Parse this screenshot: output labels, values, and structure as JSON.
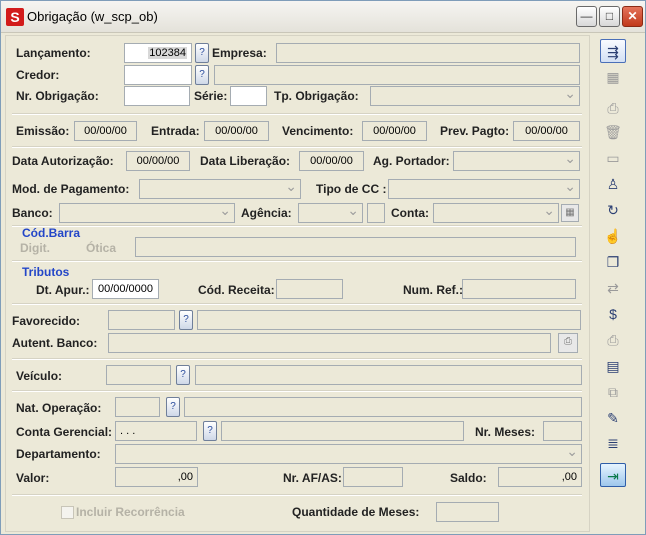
{
  "window": {
    "title": "Obrigação (w_scp_ob)",
    "app_icon": "S",
    "min_glyph": "—",
    "max_glyph": "□",
    "close_glyph": "✕"
  },
  "labels": {
    "lancamento": "Lançamento:",
    "empresa": "Empresa:",
    "credor": "Credor:",
    "nr_obrigacao": "Nr. Obrigação:",
    "serie": "Série:",
    "tp_obrigacao": "Tp. Obrigação:",
    "emissao": "Emissão:",
    "entrada": "Entrada:",
    "vencimento": "Vencimento:",
    "prev_pagto": "Prev. Pagto:",
    "data_autorizacao": "Data Autorização:",
    "data_liberacao": "Data Liberação:",
    "ag_portador": "Ag. Portador:",
    "mod_pagamento": "Mod. de Pagamento:",
    "tipo_cc": "Tipo de CC :",
    "banco": "Banco:",
    "agencia": "Agência:",
    "conta": "Conta:",
    "cod_barra": "Cód.Barra",
    "digit": "Digit.",
    "otica": "Ótica",
    "tributos": "Tributos",
    "dt_apur": "Dt. Apur.:",
    "cod_receita": "Cód. Receita:",
    "num_ref": "Num. Ref.:",
    "favorecido": "Favorecido:",
    "autent_banco": "Autent. Banco:",
    "veiculo": "Veículo:",
    "nat_operacao": "Nat. Operação:",
    "conta_gerencial": "Conta Gerencial:",
    "nr_meses": "Nr. Meses:",
    "departamento": "Departamento:",
    "valor": "Valor:",
    "nr_af_as": "Nr. AF/AS:",
    "saldo": "Saldo:",
    "incluir_recorrencia": "Incluir Recorrência",
    "quantidade_meses": "Quantidade de Meses:"
  },
  "values": {
    "lancamento": "102384",
    "emissao": "00/00/00",
    "entrada": "00/00/00",
    "vencimento": "00/00/00",
    "prev_pagto": "00/00/00",
    "data_autorizacao": "00/00/00",
    "data_liberacao": "00/00/00",
    "dt_apur": "00/00/0000",
    "conta_gerencial": ". . .",
    "valor": ",00",
    "saldo": ",00"
  },
  "toolbar": [
    {
      "name": "new-record-icon",
      "glyph": "⇶",
      "enabled": true
    },
    {
      "name": "grid-view-icon",
      "glyph": "▦",
      "enabled": false
    },
    {
      "name": "print-preview-icon",
      "glyph": "⎙",
      "enabled": false
    },
    {
      "name": "delete-icon",
      "glyph": "🗑",
      "enabled": false
    },
    {
      "name": "open-folder-icon",
      "glyph": "▭",
      "enabled": false
    },
    {
      "name": "user-icon",
      "glyph": "♙",
      "enabled": true
    },
    {
      "name": "refresh-icon",
      "glyph": "↻",
      "enabled": true
    },
    {
      "name": "approve-icon",
      "glyph": "☝",
      "enabled": true
    },
    {
      "name": "documents-icon",
      "glyph": "❐",
      "enabled": true
    },
    {
      "name": "transfer-icon",
      "glyph": "⇄",
      "enabled": false
    },
    {
      "name": "money-bag-icon",
      "glyph": "$",
      "enabled": true
    },
    {
      "name": "printer-icon",
      "glyph": "⎙",
      "enabled": false
    },
    {
      "name": "report-icon",
      "glyph": "▤",
      "enabled": true
    },
    {
      "name": "copy-icon",
      "glyph": "⧉",
      "enabled": false
    },
    {
      "name": "chart-edit-icon",
      "glyph": "✎",
      "enabled": true
    },
    {
      "name": "notes-icon",
      "glyph": "≣",
      "enabled": true
    },
    {
      "name": "exit-icon",
      "glyph": "⇥",
      "enabled": true
    }
  ]
}
